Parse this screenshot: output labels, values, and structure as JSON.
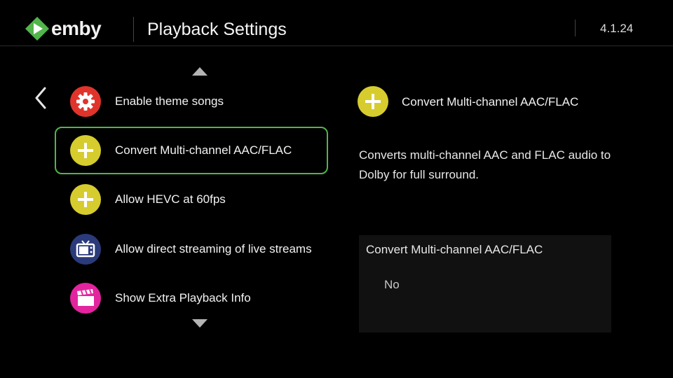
{
  "header": {
    "logo_text": "emby",
    "title": "Playback Settings",
    "version": "4.1.24"
  },
  "navigation": {
    "back_icon": "chevron-left-icon",
    "scroll_up_icon": "triangle-up-icon",
    "scroll_down_icon": "triangle-down-icon"
  },
  "settings": {
    "items": [
      {
        "label": "Enable theme songs",
        "icon": "gear-icon",
        "icon_color": "#e0342a",
        "selected": false
      },
      {
        "label": "Convert Multi-channel AAC/FLAC",
        "icon": "plus-icon",
        "icon_color": "#d6cc2e",
        "selected": true
      },
      {
        "label": "Allow HEVC at 60fps",
        "icon": "plus-icon",
        "icon_color": "#d6cc2e",
        "selected": false
      },
      {
        "label": "Allow direct streaming of live streams",
        "icon": "tv-icon",
        "icon_color": "#2b3a7a",
        "selected": false
      },
      {
        "label": "Show Extra Playback Info",
        "icon": "clapperboard-icon",
        "icon_color": "#e3249f",
        "selected": false
      }
    ]
  },
  "detail": {
    "icon": "plus-icon",
    "icon_color": "#d6cc2e",
    "title": "Convert Multi-channel AAC/FLAC",
    "description": "Converts multi-channel AAC and FLAC audio to Dolby for full surround.",
    "value_label": "Convert Multi-channel AAC/FLAC",
    "value": "No"
  },
  "colors": {
    "accent": "#52b54b",
    "background": "#000000"
  }
}
